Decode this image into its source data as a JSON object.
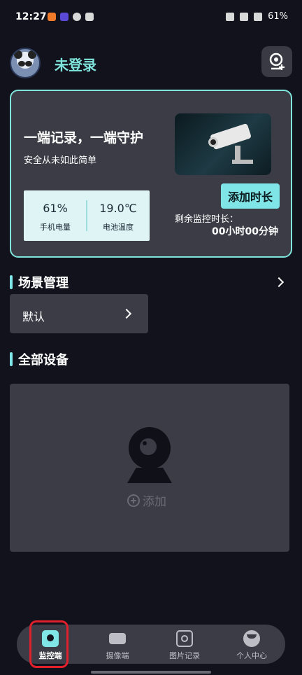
{
  "status_bar": {
    "time": "12:27",
    "battery": "61%"
  },
  "header": {
    "login_label": "未登录"
  },
  "promo": {
    "title": "一端记录，一端守护",
    "subtitle": "安全从未如此简单",
    "add_duration_button": "添加时长",
    "remaining_label": "剩余监控时长：",
    "remaining_value": "00小时00分钟",
    "stats": [
      {
        "value": "61%",
        "label": "手机电量"
      },
      {
        "value": "19.0℃",
        "label": "电池温度"
      }
    ]
  },
  "scenes": {
    "title": "场景管理",
    "items": [
      {
        "name": "默认"
      }
    ]
  },
  "devices": {
    "title": "全部设备",
    "add_label": "添加"
  },
  "nav": {
    "items": [
      {
        "label": "监控端",
        "icon": "monitor-icon",
        "active": true
      },
      {
        "label": "摄像端",
        "icon": "camera-icon",
        "active": false
      },
      {
        "label": "图片记录",
        "icon": "photo-record-icon",
        "active": false
      },
      {
        "label": "个人中心",
        "icon": "profile-icon",
        "active": false
      }
    ]
  },
  "colors": {
    "accent": "#7fe5e6",
    "background": "#12121c",
    "card": "#3c3c46",
    "highlight": "#e0202a"
  }
}
